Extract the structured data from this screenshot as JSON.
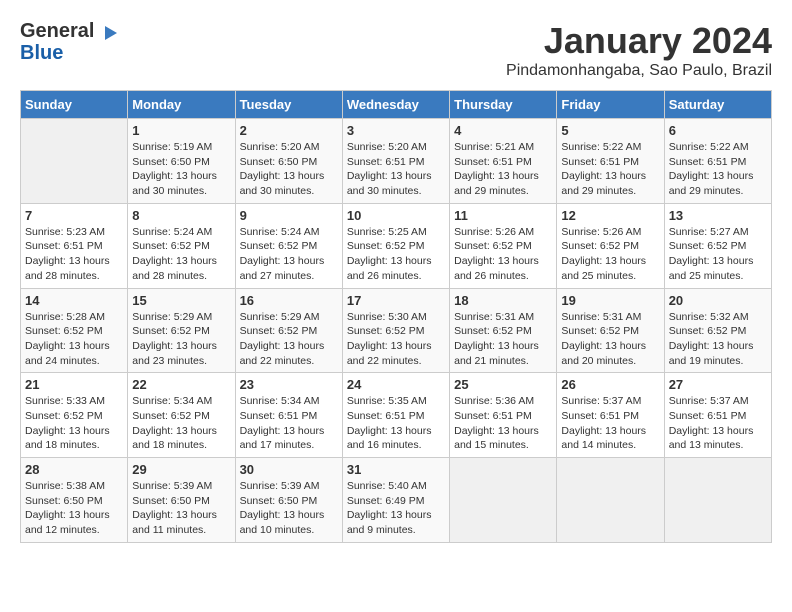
{
  "logo": {
    "general": "General",
    "blue": "Blue"
  },
  "title": "January 2024",
  "subtitle": "Pindamonhangaba, Sao Paulo, Brazil",
  "days_header": [
    "Sunday",
    "Monday",
    "Tuesday",
    "Wednesday",
    "Thursday",
    "Friday",
    "Saturday"
  ],
  "weeks": [
    [
      {
        "day": "",
        "info": ""
      },
      {
        "day": "1",
        "info": "Sunrise: 5:19 AM\nSunset: 6:50 PM\nDaylight: 13 hours\nand 30 minutes."
      },
      {
        "day": "2",
        "info": "Sunrise: 5:20 AM\nSunset: 6:50 PM\nDaylight: 13 hours\nand 30 minutes."
      },
      {
        "day": "3",
        "info": "Sunrise: 5:20 AM\nSunset: 6:51 PM\nDaylight: 13 hours\nand 30 minutes."
      },
      {
        "day": "4",
        "info": "Sunrise: 5:21 AM\nSunset: 6:51 PM\nDaylight: 13 hours\nand 29 minutes."
      },
      {
        "day": "5",
        "info": "Sunrise: 5:22 AM\nSunset: 6:51 PM\nDaylight: 13 hours\nand 29 minutes."
      },
      {
        "day": "6",
        "info": "Sunrise: 5:22 AM\nSunset: 6:51 PM\nDaylight: 13 hours\nand 29 minutes."
      }
    ],
    [
      {
        "day": "7",
        "info": "Sunrise: 5:23 AM\nSunset: 6:51 PM\nDaylight: 13 hours\nand 28 minutes."
      },
      {
        "day": "8",
        "info": "Sunrise: 5:24 AM\nSunset: 6:52 PM\nDaylight: 13 hours\nand 28 minutes."
      },
      {
        "day": "9",
        "info": "Sunrise: 5:24 AM\nSunset: 6:52 PM\nDaylight: 13 hours\nand 27 minutes."
      },
      {
        "day": "10",
        "info": "Sunrise: 5:25 AM\nSunset: 6:52 PM\nDaylight: 13 hours\nand 26 minutes."
      },
      {
        "day": "11",
        "info": "Sunrise: 5:26 AM\nSunset: 6:52 PM\nDaylight: 13 hours\nand 26 minutes."
      },
      {
        "day": "12",
        "info": "Sunrise: 5:26 AM\nSunset: 6:52 PM\nDaylight: 13 hours\nand 25 minutes."
      },
      {
        "day": "13",
        "info": "Sunrise: 5:27 AM\nSunset: 6:52 PM\nDaylight: 13 hours\nand 25 minutes."
      }
    ],
    [
      {
        "day": "14",
        "info": "Sunrise: 5:28 AM\nSunset: 6:52 PM\nDaylight: 13 hours\nand 24 minutes."
      },
      {
        "day": "15",
        "info": "Sunrise: 5:29 AM\nSunset: 6:52 PM\nDaylight: 13 hours\nand 23 minutes."
      },
      {
        "day": "16",
        "info": "Sunrise: 5:29 AM\nSunset: 6:52 PM\nDaylight: 13 hours\nand 22 minutes."
      },
      {
        "day": "17",
        "info": "Sunrise: 5:30 AM\nSunset: 6:52 PM\nDaylight: 13 hours\nand 22 minutes."
      },
      {
        "day": "18",
        "info": "Sunrise: 5:31 AM\nSunset: 6:52 PM\nDaylight: 13 hours\nand 21 minutes."
      },
      {
        "day": "19",
        "info": "Sunrise: 5:31 AM\nSunset: 6:52 PM\nDaylight: 13 hours\nand 20 minutes."
      },
      {
        "day": "20",
        "info": "Sunrise: 5:32 AM\nSunset: 6:52 PM\nDaylight: 13 hours\nand 19 minutes."
      }
    ],
    [
      {
        "day": "21",
        "info": "Sunrise: 5:33 AM\nSunset: 6:52 PM\nDaylight: 13 hours\nand 18 minutes."
      },
      {
        "day": "22",
        "info": "Sunrise: 5:34 AM\nSunset: 6:52 PM\nDaylight: 13 hours\nand 18 minutes."
      },
      {
        "day": "23",
        "info": "Sunrise: 5:34 AM\nSunset: 6:51 PM\nDaylight: 13 hours\nand 17 minutes."
      },
      {
        "day": "24",
        "info": "Sunrise: 5:35 AM\nSunset: 6:51 PM\nDaylight: 13 hours\nand 16 minutes."
      },
      {
        "day": "25",
        "info": "Sunrise: 5:36 AM\nSunset: 6:51 PM\nDaylight: 13 hours\nand 15 minutes."
      },
      {
        "day": "26",
        "info": "Sunrise: 5:37 AM\nSunset: 6:51 PM\nDaylight: 13 hours\nand 14 minutes."
      },
      {
        "day": "27",
        "info": "Sunrise: 5:37 AM\nSunset: 6:51 PM\nDaylight: 13 hours\nand 13 minutes."
      }
    ],
    [
      {
        "day": "28",
        "info": "Sunrise: 5:38 AM\nSunset: 6:50 PM\nDaylight: 13 hours\nand 12 minutes."
      },
      {
        "day": "29",
        "info": "Sunrise: 5:39 AM\nSunset: 6:50 PM\nDaylight: 13 hours\nand 11 minutes."
      },
      {
        "day": "30",
        "info": "Sunrise: 5:39 AM\nSunset: 6:50 PM\nDaylight: 13 hours\nand 10 minutes."
      },
      {
        "day": "31",
        "info": "Sunrise: 5:40 AM\nSunset: 6:49 PM\nDaylight: 13 hours\nand 9 minutes."
      },
      {
        "day": "",
        "info": ""
      },
      {
        "day": "",
        "info": ""
      },
      {
        "day": "",
        "info": ""
      }
    ]
  ]
}
